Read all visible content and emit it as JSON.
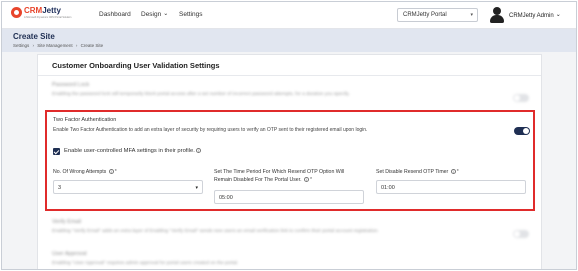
{
  "brand": {
    "name_red": "CRM",
    "name_dark": "Jetty",
    "tagline": "A Microsoft Dynamics CRM Portal Solution"
  },
  "nav": {
    "dashboard": "Dashboard",
    "design": "Design",
    "settings": "Settings"
  },
  "portal_select": {
    "value": "CRMJetty Portal"
  },
  "user": {
    "name": "CRMJetty Admin"
  },
  "page": {
    "title": "Create Site"
  },
  "breadcrumb": [
    "Settings",
    "›",
    "Site Management",
    "›",
    "Create Site"
  ],
  "card": {
    "title": "Customer Onboarding User Validation Settings"
  },
  "password_lock": {
    "label": "Password Lock",
    "description": "Enabling the password lock will temporarily block portal access after a set number of incorrect password attempts, for a duration you specify.",
    "enabled": false
  },
  "two_factor": {
    "label": "Two Factor Authentication",
    "description": "Enable Two Factor Authentication to add an extra layer of security by requiring users to verify an OTP sent to their registered email upon login.",
    "enabled": true,
    "mfa_checkbox_label": "Enable user-controlled MFA settings in their profile.",
    "mfa_checked": true,
    "wrong_attempts": {
      "label": "No. Of Wrong Attempts",
      "value": "3"
    },
    "resend_disabled": {
      "label_line1": "Set The Time Period For Which Resend OTP Option Will",
      "label_line2": "Remain Disabled For The Portal User.",
      "value": "05:00"
    },
    "disable_resend_timer": {
      "label": "Set Disable Resend OTP Timer",
      "value": "01:00"
    }
  },
  "verify_email": {
    "label": "Verify Email",
    "description": "Enabling \"Verify Email\" adds an extra layer of Enabling \"Verify Email\" sends new users an email verification link to confirm their portal account registration.",
    "enabled": false
  },
  "user_approval": {
    "label": "User Approval",
    "description": "Enabling \"User Approval\" requires admin approval for portal users created on the portal."
  },
  "colors": {
    "accent": "#1f2f53",
    "highlight_border": "#e02b2b",
    "brand_red": "#e8452c"
  },
  "icons": [
    "crmjetty-logo-icon",
    "user-avatar-icon",
    "chevron-down-icon",
    "info-icon",
    "checkbox-checked-icon"
  ]
}
